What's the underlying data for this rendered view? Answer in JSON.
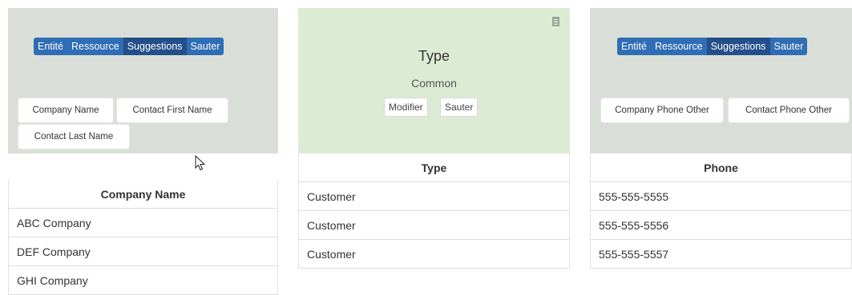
{
  "toolbar": {
    "segments": [
      "Entité",
      "Ressource",
      "Suggestions",
      "Sauter"
    ],
    "active_index": 2
  },
  "col1": {
    "chips": [
      "Company Name",
      "Contact First Name",
      "Contact Last Name"
    ],
    "header": "Company Name",
    "rows": [
      "ABC Company",
      "DEF Company",
      "GHI Company"
    ]
  },
  "col2": {
    "title": "Type",
    "subtitle": "Common",
    "buttons": [
      "Modifier",
      "Sauter"
    ],
    "header": "Type",
    "rows": [
      "Customer",
      "Customer",
      "Customer"
    ],
    "icon": "document-icon"
  },
  "col3": {
    "chips": [
      "Company Phone Other",
      "Contact Phone Other"
    ],
    "header": "Phone",
    "rows": [
      "555-555-5555",
      "555-555-5556",
      "555-555-5557"
    ]
  },
  "colors": {
    "primary": "#2f6db5",
    "primary_active": "#244f8a",
    "mapped_panel": "#d9dfd8",
    "selected_panel": "#dcecd4"
  }
}
